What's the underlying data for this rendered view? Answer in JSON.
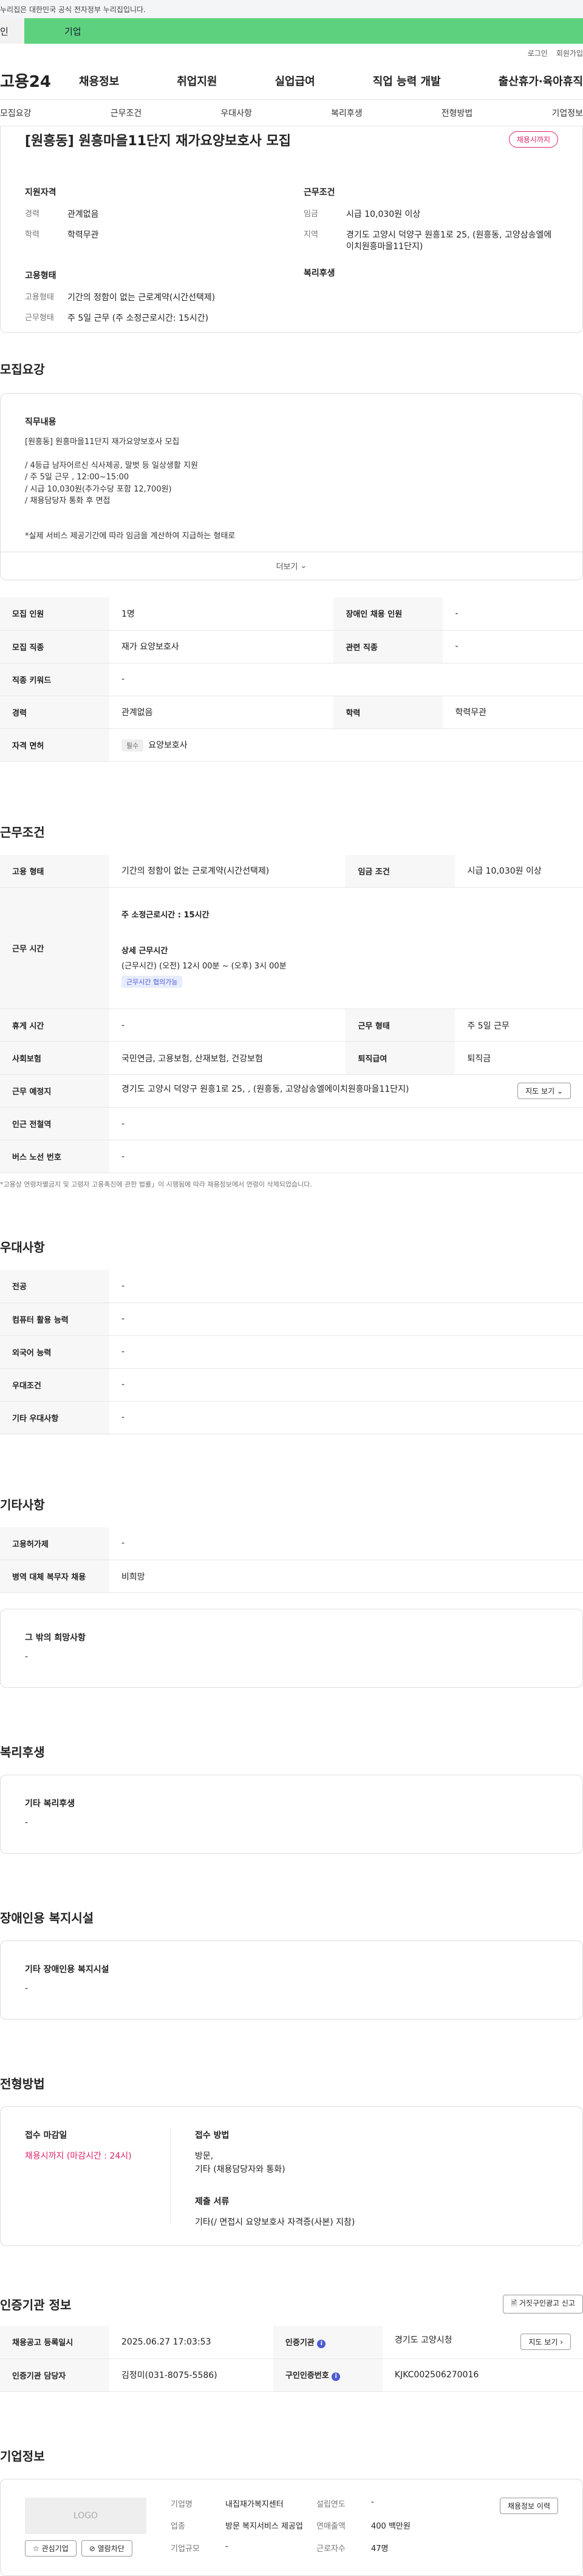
{
  "gov_bar": "누리집은 대한민국 공식 전자정부 누리집입니다.",
  "tabs": [
    "인",
    "기업"
  ],
  "util": [
    "로그인",
    "회원가입"
  ],
  "logo": "고용24",
  "gnb": [
    "채용정보",
    "취업지원",
    "실업급여",
    "직업 능력 개발",
    "출산휴가·육아휴직"
  ],
  "subnav": [
    "모집요강",
    "근무조건",
    "우대사항",
    "복리후생",
    "전형방법",
    "기업정보"
  ],
  "summary": {
    "title": "[원흥동] 원흥마을11단지 재가요양보호사 모집",
    "badge": "채용시까지",
    "qual_h": "지원자격",
    "career_k": "경력",
    "career_v": "관계없음",
    "edu_k": "학력",
    "edu_v": "학력무관",
    "cond_h": "근무조건",
    "wage_k": "임금",
    "wage_v": "시급 10,030원 이상",
    "region_k": "지역",
    "region_v": "경기도 고양시 덕양구 원흥1로 25, (원흥동, 고양삼송엘에이치원흥마을11단지)",
    "emp_h": "고용형태",
    "type_k": "고용형태",
    "type_v": "기간의 정함이 없는 근로계약(시간선택제)",
    "hours_k": "근무형태",
    "hours_v": "주 5일 근무 (주 소정근로시간: 15시간)",
    "welfare_h": "복리후생"
  },
  "recruit": {
    "heading": "모집요강",
    "duty_h": "직무내용",
    "duty_lines": [
      "[원흥동] 원흥마을11단지 재가요양보호사 모집",
      "",
      "/ 4등급 남자어르신 식사제공, 말벗 등 일상생활 지원",
      "/ 주 5일 근무 , 12:00~15:00",
      "/ 시급 10,030원(추가수당 포함 12,700원)",
      "/ 채용담당자 통화 후 면접",
      "",
      "",
      "*실제 서비스 제공기간에 따라 임금을 계산하여 지급하는 형태로"
    ],
    "more": "더보기",
    "rows": [
      [
        "모집 인원",
        "1명",
        "장애인 채용 인원",
        "-"
      ],
      [
        "모집 직종",
        "재가 요양보호사",
        "관련 직종",
        "-"
      ],
      [
        "직종 키워드",
        "-",
        "",
        ""
      ],
      [
        "경력",
        "관계없음",
        "학력",
        "학력무관"
      ]
    ],
    "license_k": "자격 면허",
    "license_tag": "필수",
    "license_v": "요양보호사"
  },
  "work": {
    "heading": "근무조건",
    "type_k": "고용 형태",
    "type_v": "기간의 정함이 없는 근로계약(시간선택제)",
    "wage_k": "임금 조건",
    "wage_v": "시급 10,030원 이상",
    "time_k": "근무 시간",
    "time_weekly": "주 소정근로시간 : 15시간",
    "time_detail_h": "상세 근무시간",
    "time_detail_v": "(근무시간) (오전) 12시 00분 ~ (오후) 3시 00분",
    "time_tag": "근무시간 협의가능",
    "rest_k": "휴게 시간",
    "rest_v": "-",
    "shift_k": "근무 형태",
    "shift_v": "주 5일 근무",
    "ins_k": "사회보험",
    "ins_v": "국민연금, 고용보험, 산재보험, 건강보험",
    "sev_k": "퇴직급여",
    "sev_v": "퇴직금",
    "place_k": "근무 예정지",
    "place_v": "경기도 고양시 덕양구 원흥1로 25, , (원흥동, 고양삼송엘에이치원흥마을11단지)",
    "map_btn": "지도 보기",
    "subway_k": "인근 전철역",
    "subway_v": "-",
    "bus_k": "버스 노선 번호",
    "bus_v": "-",
    "note": "*고용상 연령차별금지 및 고령자 고용촉진에 관한 법률」이 시행됨에 따라 채용정보에서 연령이 삭제되었습니다."
  },
  "pref": {
    "heading": "우대사항",
    "rows": [
      [
        "전공",
        "-"
      ],
      [
        "컴퓨터 활용 능력",
        "-"
      ],
      [
        "외국어 능력",
        "-"
      ],
      [
        "우대조건",
        "-"
      ],
      [
        "기타 우대사항",
        "-"
      ]
    ]
  },
  "etc": {
    "heading": "기타사항",
    "rows": [
      [
        "고용허가제",
        "-"
      ],
      [
        "병역 대체 복무자 채용",
        "비희망"
      ]
    ],
    "other_h": "그 밖의 희망사항",
    "other_v": "-"
  },
  "welfare": {
    "heading": "복리후생",
    "h": "기타 복리후생",
    "v": "-"
  },
  "disabled": {
    "heading": "장애인용 복지시설",
    "h": "기타 장애인용 복지시설",
    "v": "-"
  },
  "selection": {
    "heading": "전형방법",
    "deadline_h": "접수 마감일",
    "deadline_v": "채용시까지 (마감시간 : 24시)",
    "method_h": "접수 방법",
    "method_v1": "방문,",
    "method_v2": "기타 (채용담당자와 통화)",
    "docs_h": "제출 서류",
    "docs_v": "기타(/ 면접시 요양보호사 자격증(사본) 지참)"
  },
  "cert": {
    "heading": "인증기관 정보",
    "report_btn": "거짓구인광고 신고",
    "reg_k": "채용공고 등록일시",
    "reg_v": "2025.06.27 17:03:53",
    "org_k": "인증기관",
    "org_v": "경기도 고양시청",
    "map_btn": "지도 보기",
    "mgr_k": "인증기관 담당자",
    "mgr_v": "김정미(031-8075-5586)",
    "id_k": "구인인증번호",
    "id_v": "KJKC002506270016"
  },
  "company": {
    "heading": "기업정보",
    "logo_text": "LOGO",
    "fav_btn": "관심기업",
    "block_btn": "열람차단",
    "name_k": "기업명",
    "name_v": "내집재가복지센터",
    "year_k": "설립연도",
    "year_v": "-",
    "ind_k": "업종",
    "ind_v": "방문 복지서비스 제공업",
    "sales_k": "연매출액",
    "sales_v": "400 백만원",
    "emp_k": "근로자수",
    "emp_v": "47명",
    "size_k": "기업규모",
    "size_v": "-",
    "history_btn": "채용정보 이력"
  }
}
